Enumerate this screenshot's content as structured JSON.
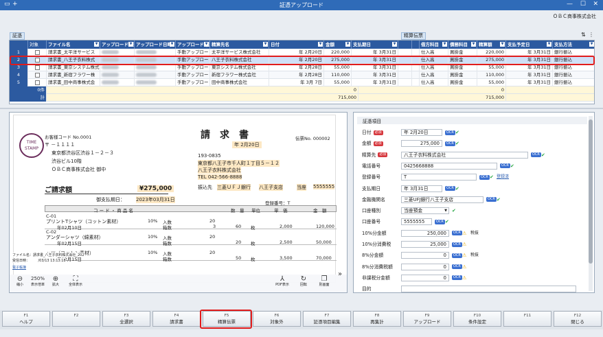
{
  "window": {
    "title": "証憑アップロード",
    "company": "ＯＢＣ商事株式会社"
  },
  "labels": {
    "voucher": "証憑",
    "settlement": "精算伝票"
  },
  "grid": {
    "headers": [
      "対象",
      "ファイル名",
      "アップロード担当",
      "アップロード日時",
      "アップロード方法",
      "精算先名",
      "日付",
      "金額",
      "支払期日",
      "",
      "精算伝票",
      "借方科目",
      "債務科目",
      "精算額",
      "支払予定日",
      "支払方法"
    ],
    "rows": [
      {
        "no": "1",
        "file": "請求書_太平洋サービス",
        "method": "手動アップロード",
        "payee": "太平洋サービス株式会社",
        "date": "年  2月20日",
        "amount": "220,000",
        "due": "年  3月31日",
        "debit": "仕入高",
        "credit": "買掛金",
        "settle": "220,000",
        "paydate": "年  3月31日",
        "paym": "銀行振込"
      },
      {
        "no": "2",
        "file": "請求書_八王子衣料株式",
        "method": "手動アップロード",
        "payee": "八王子衣料株式会社",
        "date": "年  2月20日",
        "amount": "275,000",
        "due": "年  3月31日",
        "debit": "仕入高",
        "credit": "買掛金",
        "settle": "275,000",
        "paydate": "年  3月31日",
        "paym": "銀行振込"
      },
      {
        "no": "3",
        "file": "請求書_東京システム株式",
        "method": "手動アップロード",
        "payee": "東京システム株式会社",
        "date": "年  2月28日",
        "amount": "55,000",
        "due": "年  3月31日",
        "debit": "仕入高",
        "credit": "買掛金",
        "settle": "55,000",
        "paydate": "年  3月31日",
        "paym": "銀行振込"
      },
      {
        "no": "4",
        "file": "請求書_新宿フラワー株",
        "method": "手動アップロード",
        "payee": "新宿フラワー株式会社",
        "date": "年  2月28日",
        "amount": "110,000",
        "due": "年  3月31日",
        "debit": "仕入高",
        "credit": "買掛金",
        "settle": "110,000",
        "paydate": "年  3月31日",
        "paym": "銀行振込"
      },
      {
        "no": "5",
        "file": "請求書_田中商事株式会",
        "method": "手動アップロード",
        "payee": "田中商事株式会社",
        "date": "年  3月  7日",
        "amount": "55,000",
        "due": "年  3月31日",
        "debit": "仕入高",
        "credit": "買掛金",
        "settle": "55,000",
        "paydate": "年  3月31日",
        "paym": "銀行振込"
      }
    ],
    "zero_label": "0件",
    "zero_amount": "0",
    "zero_settle": "0",
    "total_label": "計",
    "total_amount": "715,000",
    "total_settle": "715,000"
  },
  "invoice": {
    "customer_no": "お客様コード No.0001",
    "stamp": "TIME STAMP",
    "addr1": "〒 －１１１１",
    "addr2": "東京都渋谷区渋谷１－２－３",
    "addr3": "渋谷ビル10階",
    "to": "ＯＢＣ商事株式会社  御中",
    "title": "請　求　書",
    "invoice_no": "伝票No. 000002",
    "issue_date": "年  2月20日",
    "s_zip": "193-0835",
    "s_addr": "東京都八王子市千人町１丁目５－１２",
    "s_name": "八王子衣料株式会社",
    "s_tel": "TEL  042-566-8888",
    "bank_label": "振込先",
    "bank_name": "三菱ＵＦＪ銀行",
    "bank_branch": "八王子支店",
    "bank_type": "当座",
    "bank_no": "5555555",
    "amount_label": "ご請求額",
    "amount": "¥275,000",
    "due_label": "御支払期日：",
    "due": "2023年03月31日",
    "reg_label": "登録番号：T",
    "col_code": "コ ー ド ・ 商 品 名",
    "col_qty": "数　量",
    "col_unit": "単位",
    "col_price": "単　価",
    "col_amount": "金　額",
    "items": [
      {
        "code": "C-01",
        "name": "プリントTシャツ（コットン素材）",
        "tax": "10%",
        "in": "入数",
        "in_v": "20",
        "box": "箱数",
        "box_v": "3",
        "qty": "60",
        "unit": "枚",
        "price": "2,000",
        "amount": "120,000",
        "date": "年02月10日"
      },
      {
        "code": "C-02",
        "name": "アンダーシャツ（綿素材）",
        "tax": "10%",
        "in": "入数",
        "in_v": "20",
        "box": "箱数",
        "box_v": "",
        "qty": "20",
        "unit": "枚",
        "price": "2,500",
        "amount": "50,000",
        "date": "年02月15日"
      },
      {
        "code": "",
        "name": "ャツ（コットン素材）",
        "tax": "10%",
        "in": "入数",
        "in_v": "20",
        "box": "箱数",
        "box_v": "",
        "qty": "50",
        "unit": "枚",
        "price": "3,500",
        "amount": "70,000",
        "date": "年02月15日"
      }
    ],
    "file_info": "ファイル名：請求書_八王子衣料株式会社_202",
    "upload_info": "受信日時：　　　/03/13 13:13:18",
    "ebook": "電子帳簿",
    "zoom": "250%",
    "tools": [
      "縮小",
      "表示倍率",
      "拡大",
      "全体表示",
      "PDF表示",
      "回転",
      "別画面"
    ]
  },
  "fields": {
    "section": "証憑項目",
    "date_label": "日付",
    "date_value": "年  2月20日",
    "amount_label": "金額",
    "amount_value": "275,000",
    "payee_label": "精算先",
    "payee_value": "八王子衣料株式会社",
    "phone_label": "電話番号",
    "phone_value": "0425668888",
    "zip_label": "口座番号",
    "zip_value": "",
    "reg_label": "登録番号",
    "reg_value": "T",
    "reg_link": "登録済",
    "due_label": "支払期日",
    "due_value": "年  3月31日",
    "bank_label": "金融機関名",
    "bank_value": "三菱UFJ銀行八王子支店",
    "acct_type_label": "口座種別",
    "acct_type_value": "当座預金",
    "acct_no_label": "口座番号",
    "acct_no_value": "5555555",
    "t10_label": "10%分金額",
    "t10_value": "250,000",
    "t10_tag": "税抜",
    "t10tax_label": "10%分消費税",
    "t10tax_value": "25,000",
    "t8_label": "8%分金額",
    "t8_value": "0",
    "t8_tag": "税抜",
    "t8tax_label": "8%分消費税額",
    "t8tax_value": "0",
    "nontax_label": "非課税分金額",
    "nontax_value": "0",
    "purpose_label": "目的",
    "purpose_value": "",
    "req": "必須",
    "ocr": "OCR"
  },
  "fkeys": [
    {
      "k": "F1",
      "l": "ヘルプ"
    },
    {
      "k": "F2",
      "l": ""
    },
    {
      "k": "F3",
      "l": "全選択"
    },
    {
      "k": "F4",
      "l": "請求書"
    },
    {
      "k": "F5",
      "l": "精算伝票"
    },
    {
      "k": "F6",
      "l": "対象外"
    },
    {
      "k": "F7",
      "l": "証憑項目編集"
    },
    {
      "k": "F8",
      "l": "再集計"
    },
    {
      "k": "F9",
      "l": "アップロード"
    },
    {
      "k": "F10",
      "l": "条件設定"
    },
    {
      "k": "F11",
      "l": ""
    },
    {
      "k": "F12",
      "l": "閉じる"
    }
  ]
}
